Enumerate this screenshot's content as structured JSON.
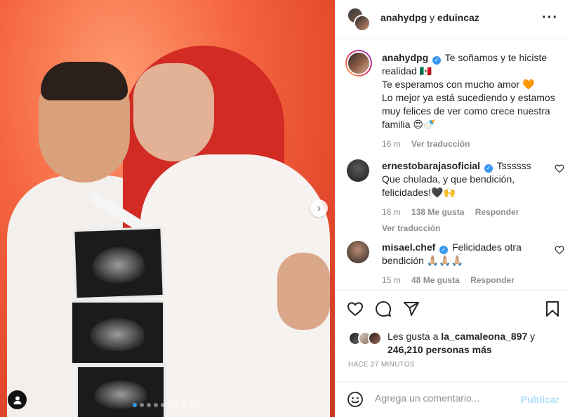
{
  "post": {
    "carousel": {
      "slide_count": 10,
      "active_index": 0
    }
  },
  "header": {
    "user1": "anahydpg",
    "connector": "y",
    "user2": "eduincaz",
    "more_icon": "more-horizontal-icon"
  },
  "caption": {
    "username": "anahydpg",
    "line1": "Te soñamos y te hiciste realidad 🇲🇽",
    "line2": "Te esperamos con mucho amor 🧡",
    "line3": "Lo mejor ya está sucediendo y estamos muy felices de ver como crece nuestra familia 😍🍼",
    "time": "16 m",
    "translate": "Ver traducción"
  },
  "comments": [
    {
      "username": "ernestobarajasoficial",
      "text": "Tssssss Que chulada, y que bendición, felicidades!🖤🙌",
      "time": "18 m",
      "likes": "138 Me gusta",
      "reply": "Responder",
      "translate": "Ver traducción"
    },
    {
      "username": "misael.chef",
      "text": "Felicidades otra bendición 🙏🏼🙏🏼🙏🏼",
      "time": "15 m",
      "likes": "48 Me gusta",
      "reply": "Responder"
    }
  ],
  "likes": {
    "prefix": "Les gusta a",
    "user": "la_camaleona_897",
    "connector": "y",
    "count": "246,210 personas más"
  },
  "timestamp": "HACE 27 MINUTOS",
  "add_comment": {
    "placeholder": "Agrega un comentario...",
    "publish": "Publicar"
  },
  "colors": {
    "accent": "#3897f0",
    "publish_disabled": "#b2dffc",
    "muted": "#8e8e8e"
  }
}
